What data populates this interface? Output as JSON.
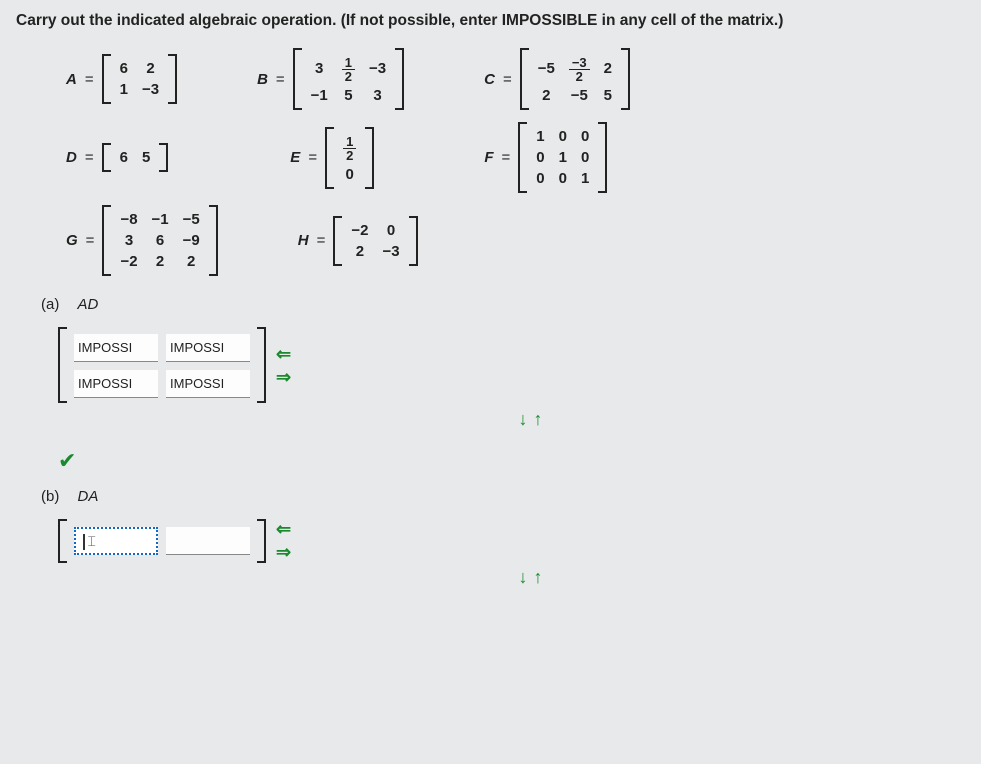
{
  "instruction": "Carry out the indicated algebraic operation. (If not possible, enter IMPOSSIBLE in any cell of the matrix.)",
  "matrices": {
    "A": {
      "name": "A",
      "rows": [
        [
          "6",
          "2"
        ],
        [
          "1",
          "−3"
        ]
      ]
    },
    "B": {
      "name": "B",
      "rows": [
        [
          "3",
          "1/2",
          "−3"
        ],
        [
          "−1",
          "5",
          "3"
        ]
      ]
    },
    "C": {
      "name": "C",
      "rows": [
        [
          "−5",
          "-3/2",
          "2"
        ],
        [
          "2",
          "−5",
          "5"
        ]
      ]
    },
    "D": {
      "name": "D",
      "rows": [
        [
          "6",
          "5"
        ]
      ]
    },
    "E": {
      "name": "E",
      "rows": [
        [
          "1/2"
        ],
        [
          "0"
        ]
      ]
    },
    "F": {
      "name": "F",
      "rows": [
        [
          "1",
          "0",
          "0"
        ],
        [
          "0",
          "1",
          "0"
        ],
        [
          "0",
          "0",
          "1"
        ]
      ]
    },
    "G": {
      "name": "G",
      "rows": [
        [
          "−8",
          "−1",
          "−5"
        ],
        [
          "3",
          "6",
          "−9"
        ],
        [
          "−2",
          "2",
          "2"
        ]
      ]
    },
    "H": {
      "name": "H",
      "rows": [
        [
          "−2",
          "0"
        ],
        [
          "2",
          "−3"
        ]
      ]
    }
  },
  "parts": {
    "a": {
      "label": "(a)",
      "expr": "AD",
      "answer": [
        [
          "IMPOSSI",
          "IMPOSSI"
        ],
        [
          "IMPOSSI",
          "IMPOSSI"
        ]
      ],
      "correct": true
    },
    "b": {
      "label": "(b)",
      "expr": "DA",
      "answer": [
        [
          "",
          ""
        ]
      ],
      "active_cell": [
        0,
        0
      ]
    }
  },
  "controls": {
    "left": "⇐",
    "right": "⇒",
    "down": "↓",
    "up": "↑"
  },
  "icons": {
    "check": "✔"
  },
  "equals": "="
}
